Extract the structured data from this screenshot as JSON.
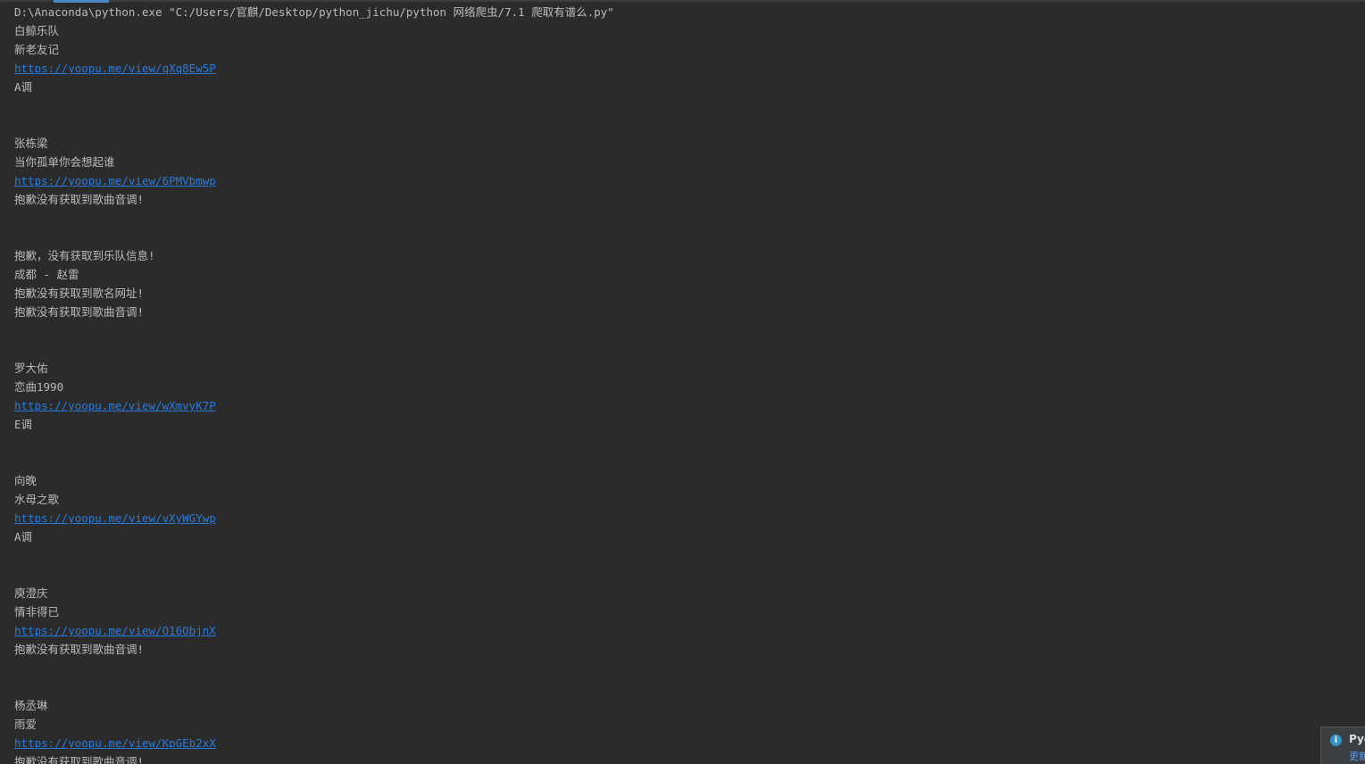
{
  "console": {
    "lines": [
      {
        "text": "D:\\Anaconda\\python.exe \"C:/Users/官麒/Desktop/python_jichu/python 网络爬虫/7.1 爬取有谱么.py\"",
        "link": false
      },
      {
        "text": "白鲸乐队",
        "link": false
      },
      {
        "text": "新老友记",
        "link": false
      },
      {
        "text": "https://yoopu.me/view/qXq8Ew5P",
        "link": true
      },
      {
        "text": "A调",
        "link": false
      },
      {
        "text": "",
        "link": false
      },
      {
        "text": "",
        "link": false
      },
      {
        "text": "张栋梁",
        "link": false
      },
      {
        "text": "当你孤单你会想起谁",
        "link": false
      },
      {
        "text": "https://yoopu.me/view/6PMVbmwp",
        "link": true
      },
      {
        "text": "抱歉没有获取到歌曲音调!",
        "link": false
      },
      {
        "text": "",
        "link": false
      },
      {
        "text": "",
        "link": false
      },
      {
        "text": "抱歉，没有获取到乐队信息!",
        "link": false
      },
      {
        "text": "成都 - 赵雷",
        "link": false
      },
      {
        "text": "抱歉没有获取到歌名网址!",
        "link": false
      },
      {
        "text": "抱歉没有获取到歌曲音调!",
        "link": false
      },
      {
        "text": "",
        "link": false
      },
      {
        "text": "",
        "link": false
      },
      {
        "text": "罗大佑",
        "link": false
      },
      {
        "text": "恋曲1990",
        "link": false
      },
      {
        "text": "https://yoopu.me/view/wXmvyK7P",
        "link": true
      },
      {
        "text": "E调",
        "link": false
      },
      {
        "text": "",
        "link": false
      },
      {
        "text": "",
        "link": false
      },
      {
        "text": "向晚",
        "link": false
      },
      {
        "text": "水母之歌",
        "link": false
      },
      {
        "text": "https://yoopu.me/view/vXyWGYwp",
        "link": true
      },
      {
        "text": "A调",
        "link": false
      },
      {
        "text": "",
        "link": false
      },
      {
        "text": "",
        "link": false
      },
      {
        "text": "庾澄庆",
        "link": false
      },
      {
        "text": "情非得已",
        "link": false
      },
      {
        "text": "https://yoopu.me/view/O16ObjnX",
        "link": true
      },
      {
        "text": "抱歉没有获取到歌曲音调!",
        "link": false
      },
      {
        "text": "",
        "link": false
      },
      {
        "text": "",
        "link": false
      },
      {
        "text": "杨丞琳",
        "link": false
      },
      {
        "text": "雨爱",
        "link": false
      },
      {
        "text": "https://yoopu.me/view/KpGEb2xX",
        "link": true
      },
      {
        "text": "抱歉没有获取到歌曲音调!",
        "link": false
      }
    ]
  },
  "notification": {
    "icon": "info-icon",
    "icon_glyph": "i",
    "title": "Pyc",
    "link": "更新"
  },
  "colors": {
    "background": "#2b2b2b",
    "text": "#bbbbbb",
    "link": "#287bde"
  }
}
